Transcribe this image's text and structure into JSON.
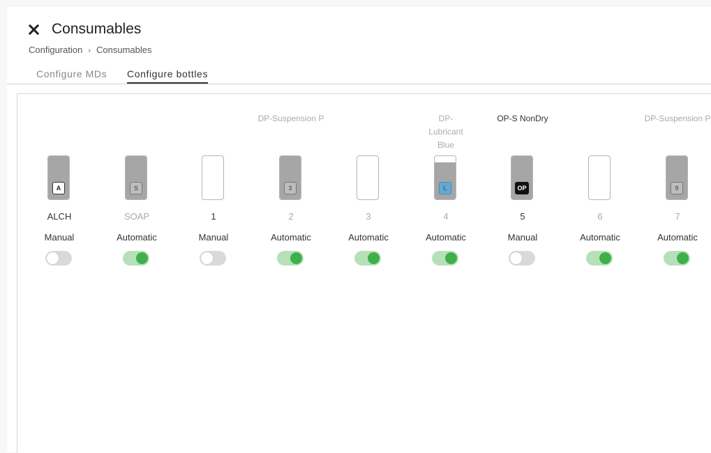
{
  "header": {
    "title": "Consumables",
    "close_icon": "close-icon"
  },
  "breadcrumb": {
    "items": [
      "Configuration",
      "Consumables"
    ],
    "separator": "›"
  },
  "tabs": [
    {
      "label": "Configure MDs",
      "active": false
    },
    {
      "label": "Configure bottles",
      "active": true
    }
  ],
  "colors": {
    "toggle_on_track": "#b6e0b8",
    "toggle_on_knob": "#3faf4a",
    "toggle_off_track": "#d9d9d9",
    "badge_blue": "#63a9d6"
  },
  "bottles": [
    {
      "name": "",
      "badge": "A",
      "badge_style": "white",
      "fill_level": 1.0,
      "label": "ALCH",
      "label_active": true,
      "mode": "Manual",
      "toggle_on": false
    },
    {
      "name": "",
      "badge": "S",
      "badge_style": "gray",
      "fill_level": 1.0,
      "label": "SOAP",
      "label_active": false,
      "mode": "Automatic",
      "toggle_on": true
    },
    {
      "name": "",
      "badge": "",
      "badge_style": "none",
      "fill_level": 0.0,
      "label": "1",
      "label_active": true,
      "mode": "Manual",
      "toggle_on": false
    },
    {
      "name": "DP-Suspension P",
      "badge": "3",
      "badge_style": "gray",
      "fill_level": 1.0,
      "label": "2",
      "label_active": false,
      "mode": "Automatic",
      "toggle_on": true
    },
    {
      "name": "",
      "badge": "",
      "badge_style": "none",
      "fill_level": 0.0,
      "label": "3",
      "label_active": false,
      "mode": "Automatic",
      "toggle_on": true
    },
    {
      "name": "DP-Lubricant Blue",
      "badge": "L",
      "badge_style": "blue",
      "fill_level": 0.85,
      "label": "4",
      "label_active": false,
      "mode": "Automatic",
      "toggle_on": true
    },
    {
      "name": "OP-S NonDry",
      "badge": "OP",
      "badge_style": "black",
      "fill_level": 1.0,
      "label": "5",
      "label_active": true,
      "mode": "Manual",
      "toggle_on": false
    },
    {
      "name": "",
      "badge": "",
      "badge_style": "none",
      "fill_level": 0.0,
      "label": "6",
      "label_active": false,
      "mode": "Automatic",
      "toggle_on": true
    },
    {
      "name": "DP-Suspension P",
      "badge": "9",
      "badge_style": "gray",
      "fill_level": 1.0,
      "label": "7",
      "label_active": false,
      "mode": "Automatic",
      "toggle_on": true
    }
  ]
}
